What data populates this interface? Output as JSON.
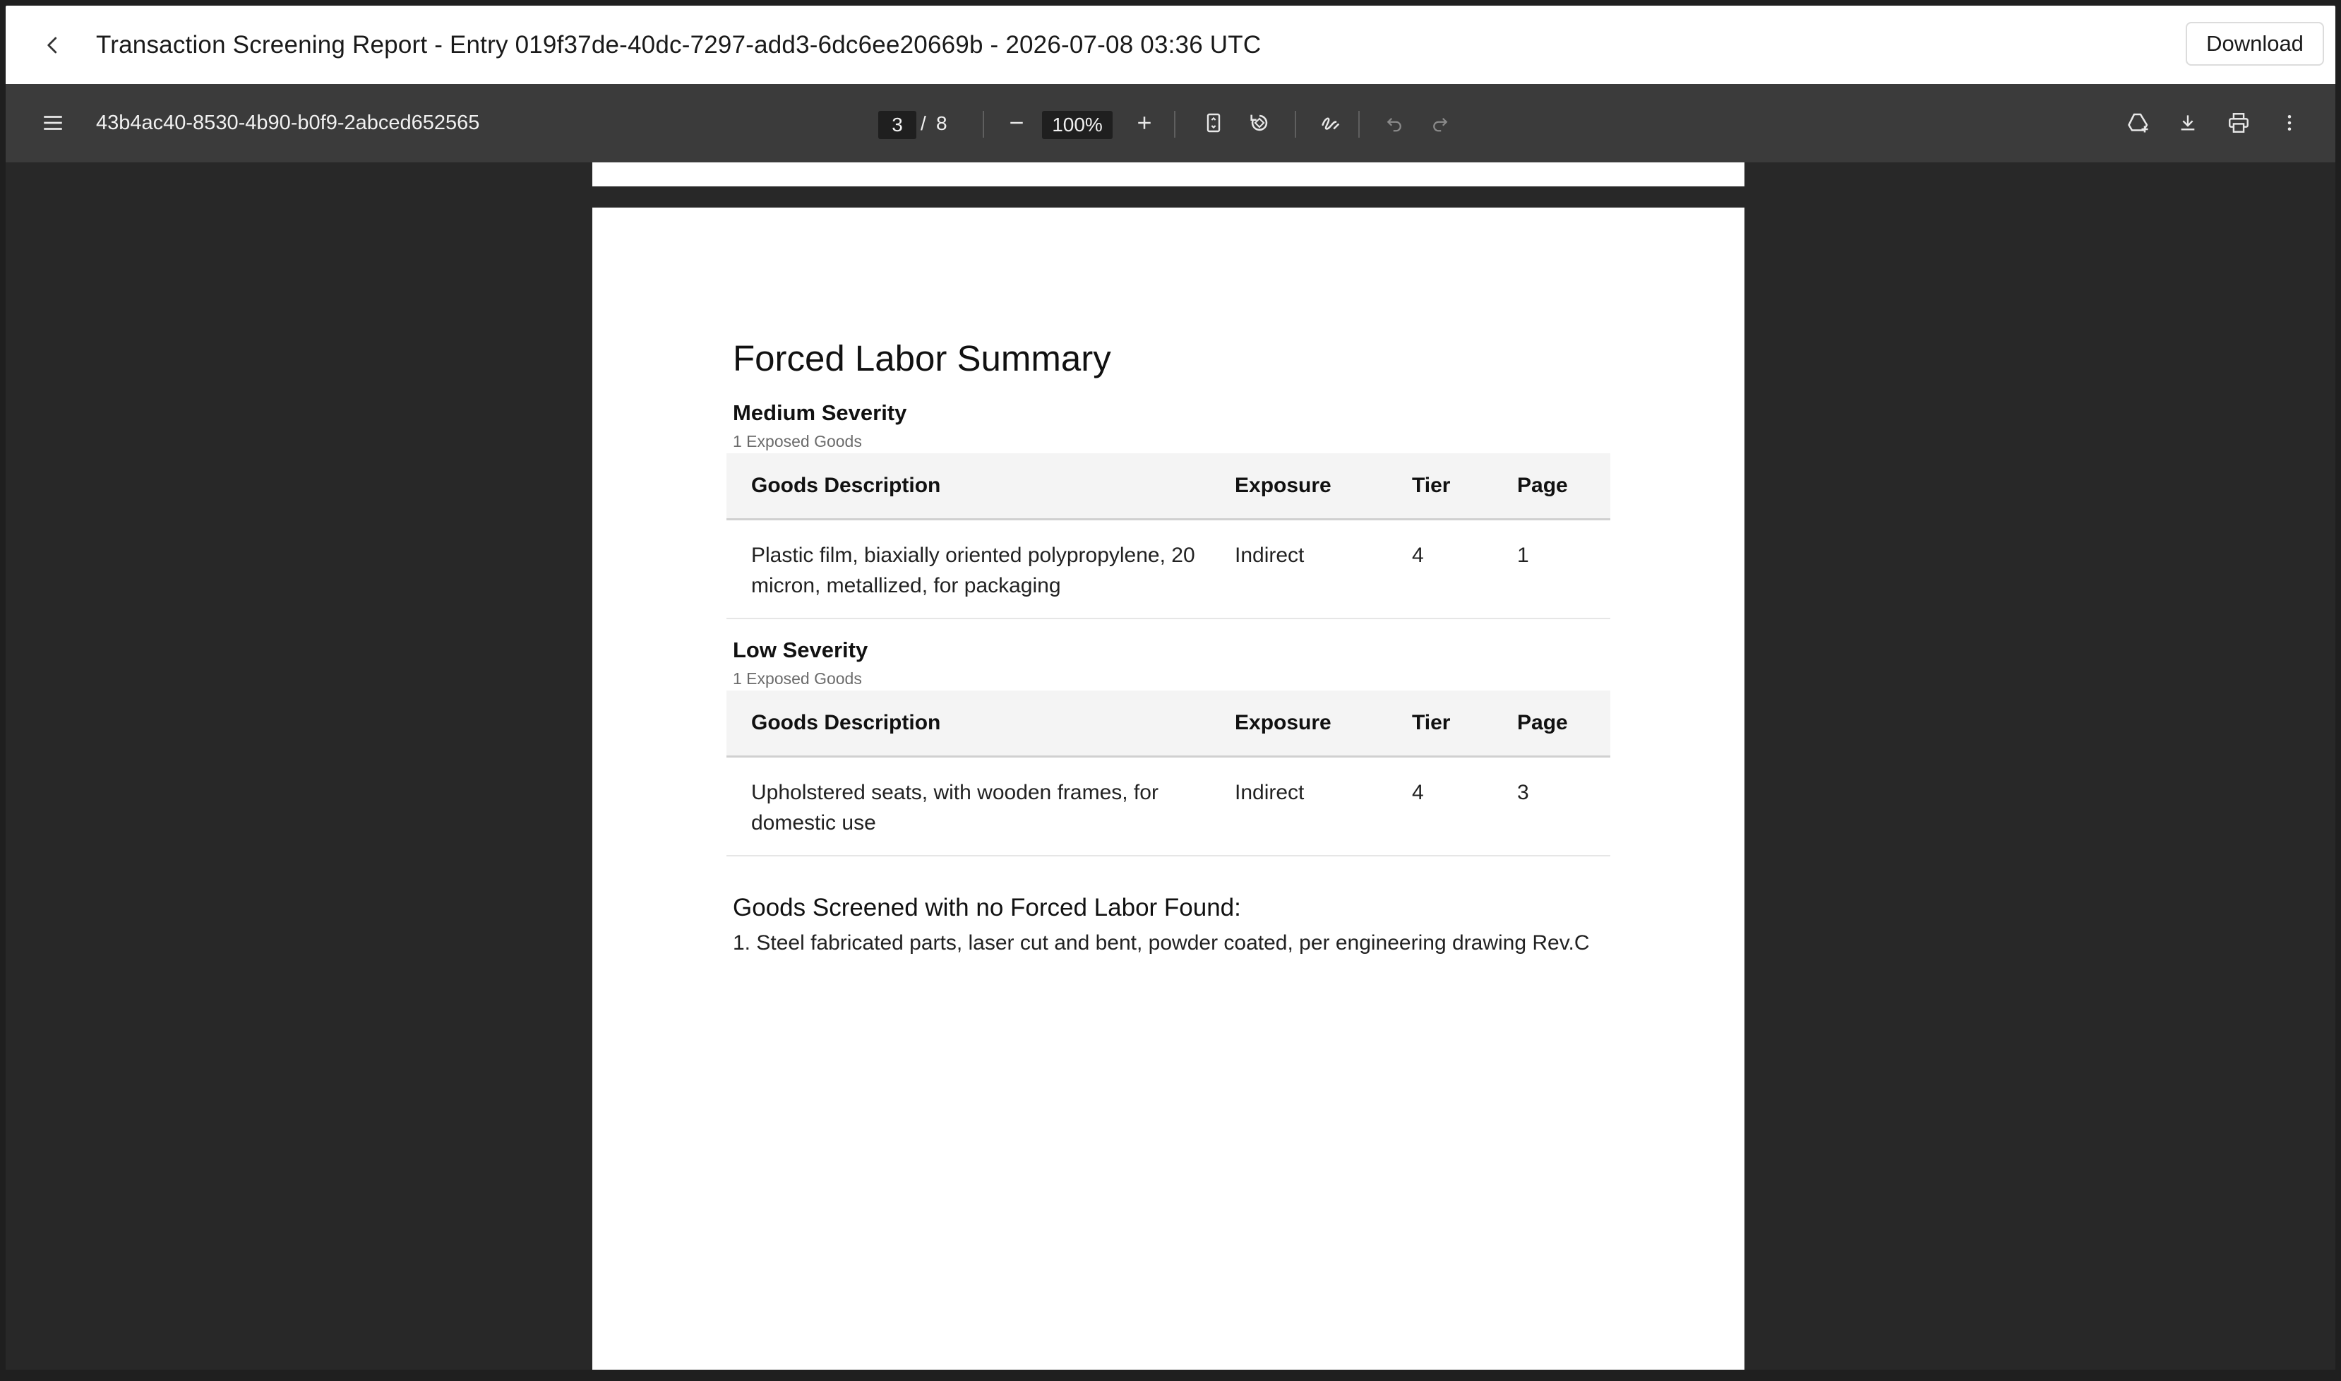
{
  "header": {
    "title": "Transaction Screening Report - Entry 019f37de-40dc-7297-add3-6dc6ee20669b - 2026-07-08 03:36 UTC",
    "download_label": "Download"
  },
  "viewer": {
    "document_name": "43b4ac40-8530-4b90-b0f9-2abced652565",
    "current_page": "3",
    "page_separator": "/",
    "total_pages": "8",
    "zoom": "100%"
  },
  "icons": {
    "back": "chevron-left-icon",
    "menu": "hamburger-menu-icon",
    "zoom_out": "minus-icon",
    "zoom_in": "plus-icon",
    "fit_page": "fit-to-page-icon",
    "rotate": "rotate-icon",
    "annotate": "annotate-pen-icon",
    "undo": "undo-icon",
    "redo": "redo-icon",
    "drive": "add-to-drive-icon",
    "save": "download-icon",
    "print": "print-icon",
    "more": "more-vertical-icon"
  },
  "colors": {
    "toolbar_bg": "#3b3b3b",
    "viewer_bg": "#282828",
    "header_bg": "#ffffff",
    "table_header_bg": "#f4f4f4"
  },
  "report": {
    "heading": "Forced Labor Summary",
    "sections": [
      {
        "severity": "Medium Severity",
        "count": "1 Exposed Goods",
        "columns": [
          "Goods Description",
          "Exposure",
          "Tier",
          "Page"
        ],
        "rows": [
          {
            "description": "Plastic film, biaxially oriented polypropylene, 20 micron, metallized, for packaging",
            "exposure": "Indirect",
            "tier": "4",
            "page": "1"
          }
        ]
      },
      {
        "severity": "Low Severity",
        "count": "1 Exposed Goods",
        "columns": [
          "Goods Description",
          "Exposure",
          "Tier",
          "Page"
        ],
        "rows": [
          {
            "description": "Upholstered seats, with wooden frames, for domestic use",
            "exposure": "Indirect",
            "tier": "4",
            "page": "3"
          }
        ]
      }
    ],
    "screened_heading": "Goods Screened with no Forced Labor Found:",
    "screened_items": [
      "1. Steel fabricated parts, laser cut and bent, powder coated, per engineering drawing Rev.C"
    ]
  }
}
